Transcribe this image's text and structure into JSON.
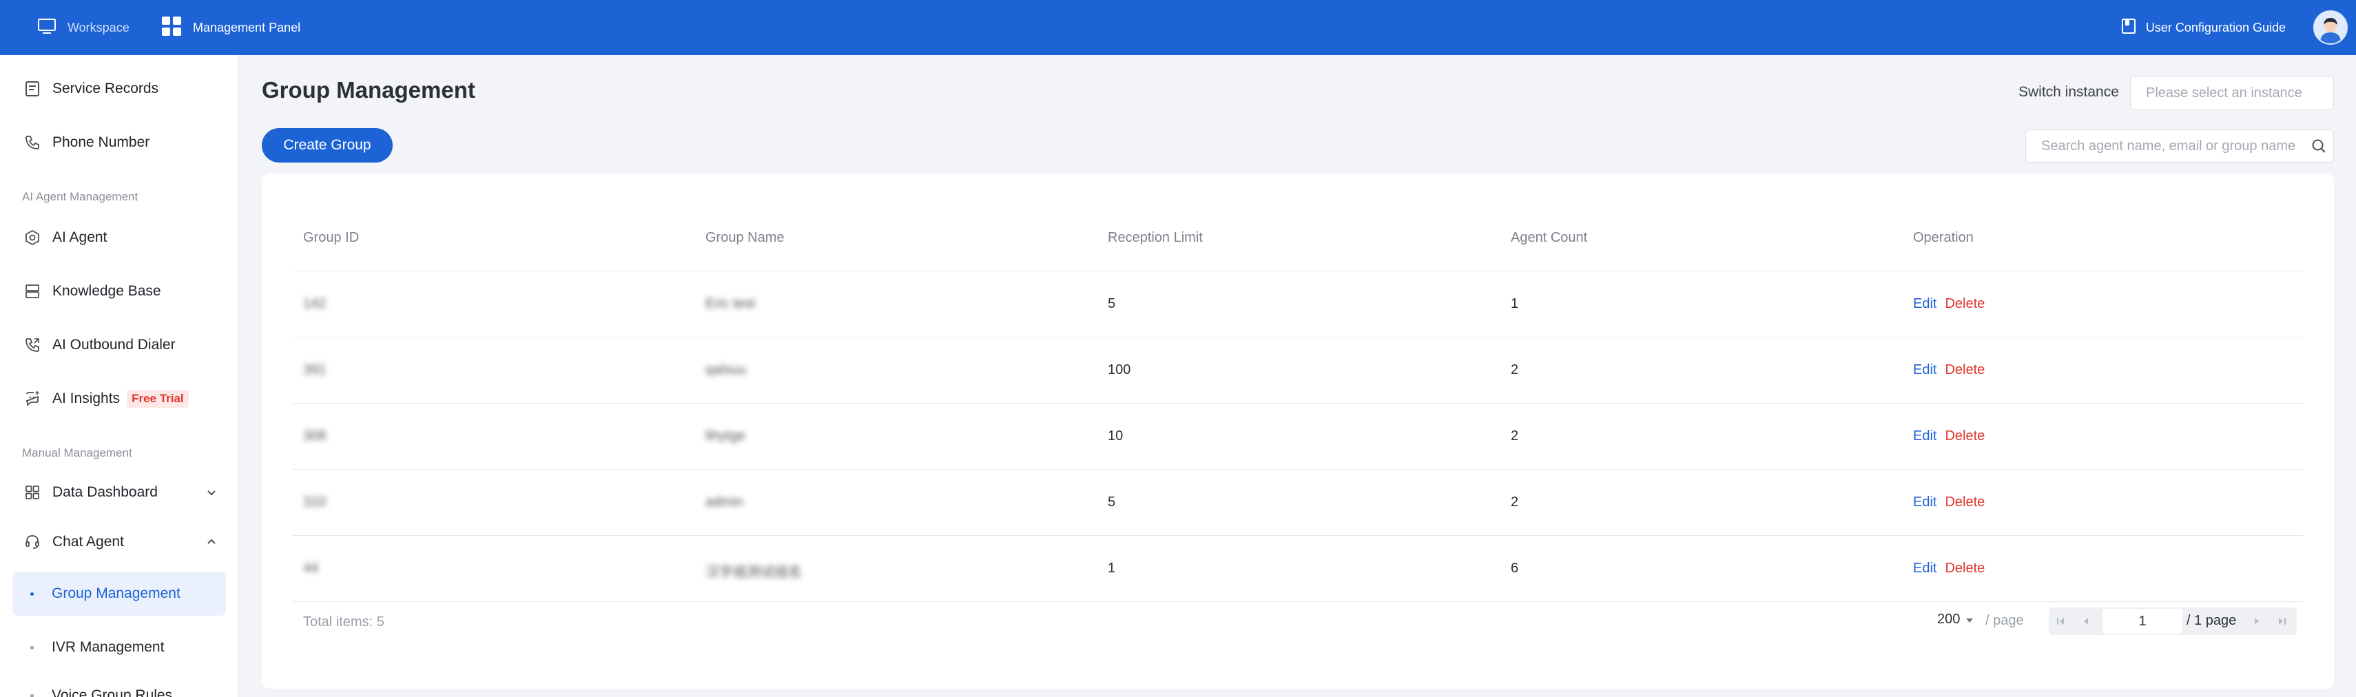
{
  "topbar": {
    "workspace_label": "Workspace",
    "panel_label": "Management Panel",
    "guide_label": "User Configuration Guide",
    "color": "#1d63d6"
  },
  "sidebar": {
    "items": [
      {
        "label": "Service Records",
        "icon": "document-icon"
      },
      {
        "label": "Phone Number",
        "icon": "phone-icon"
      }
    ],
    "section_ai": "AI Agent Management",
    "ai_items": [
      {
        "label": "AI Agent",
        "icon": "hexagon-gear-icon"
      },
      {
        "label": "Knowledge Base",
        "icon": "database-icon"
      },
      {
        "label": "AI Outbound Dialer",
        "icon": "phone-outgoing-icon"
      },
      {
        "label": "AI Insights",
        "icon": "chat-sparkle-icon",
        "badge": "Free Trial"
      }
    ],
    "section_manual": "Manual Management",
    "manual_items": [
      {
        "label": "Data Dashboard",
        "icon": "grid-icon"
      },
      {
        "label": "Chat Agent",
        "icon": "headset-icon"
      }
    ],
    "sub_items": [
      {
        "label": "Group Management",
        "active": true
      },
      {
        "label": "IVR Management",
        "active": false
      },
      {
        "label": "Voice Group Rules",
        "active": false
      }
    ]
  },
  "main": {
    "title": "Group Management",
    "switch_label": "Switch instance",
    "instance_placeholder": "Please select an instance",
    "create_label": "Create Group",
    "search_placeholder": "Search agent name, email or group name"
  },
  "table": {
    "columns": [
      "Group ID",
      "Group Name",
      "Reception Limit",
      "Agent Count",
      "Operation"
    ],
    "rows": [
      {
        "id": "142",
        "name": "Eric test",
        "limit": "5",
        "count": "1"
      },
      {
        "id": "391",
        "name": "qalsuu",
        "limit": "100",
        "count": "2"
      },
      {
        "id": "308",
        "name": "lihytge",
        "limit": "10",
        "count": "2"
      },
      {
        "id": "310",
        "name": "admin",
        "limit": "5",
        "count": "2"
      },
      {
        "id": "44",
        "name": "汉字组测试组名",
        "limit": "1",
        "count": "6"
      }
    ],
    "edit_label": "Edit",
    "delete_label": "Delete"
  },
  "pagination": {
    "total_label": "Total items:",
    "total": "5",
    "page_size": "200",
    "per_page_label": "/ page",
    "current_page": "1",
    "total_pages_label": "/ 1 page"
  }
}
